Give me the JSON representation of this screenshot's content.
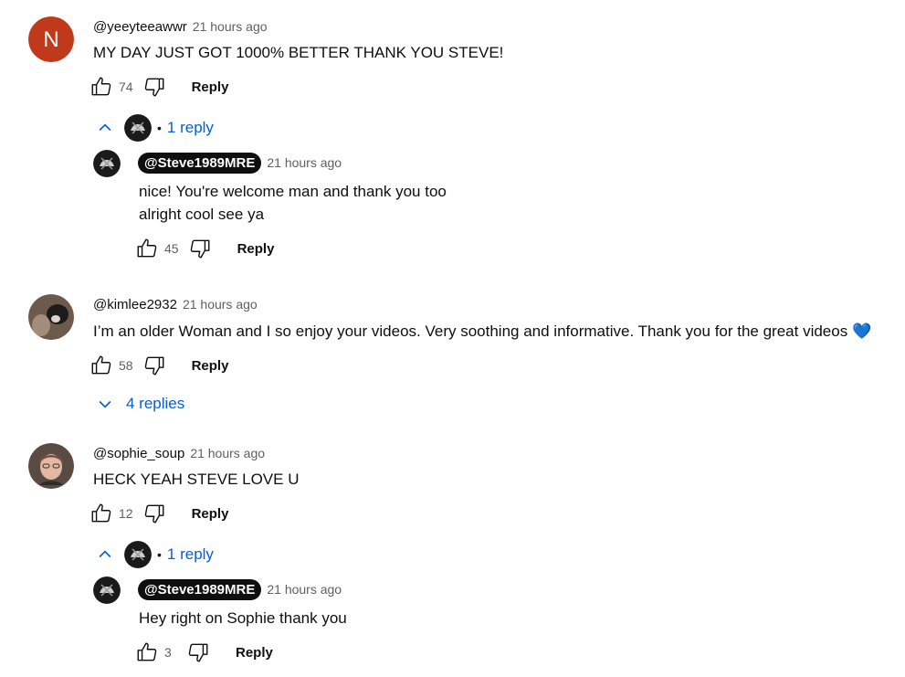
{
  "threads": [
    {
      "author": "@yeeyteeawwr",
      "time": "21 hours ago",
      "text": "MY DAY JUST GOT 1000% BETTER THANK YOU STEVE!",
      "likes": "74",
      "reply_label": "Reply",
      "avatar_letter": "N",
      "toggle_label": "1 reply",
      "reply": {
        "author": "@Steve1989MRE",
        "time": "21 hours ago",
        "lines": [
          "nice! You're welcome man and thank you too",
          "alright cool see ya"
        ],
        "likes": "45",
        "reply_label": "Reply"
      }
    },
    {
      "author": "@kimlee2932",
      "time": "21 hours ago",
      "text": "I’m an older Woman and I so enjoy your videos. Very soothing and informative. Thank you for the great videos 💙",
      "likes": "58",
      "reply_label": "Reply",
      "toggle_label": "4 replies"
    },
    {
      "author": "@sophie_soup",
      "time": "21 hours ago",
      "text": "HECK YEAH STEVE LOVE U",
      "likes": "12",
      "reply_label": "Reply",
      "toggle_label": "1 reply",
      "reply": {
        "author": "@Steve1989MRE",
        "time": "21 hours ago",
        "lines": [
          "Hey right on Sophie thank you"
        ],
        "likes": "3",
        "reply_label": "Reply"
      }
    }
  ],
  "colors": {
    "link_blue": "#065fd4",
    "avatar_n": "#c0391b",
    "channel_chip": "#0f0f0f",
    "secondary_text": "#606060"
  }
}
